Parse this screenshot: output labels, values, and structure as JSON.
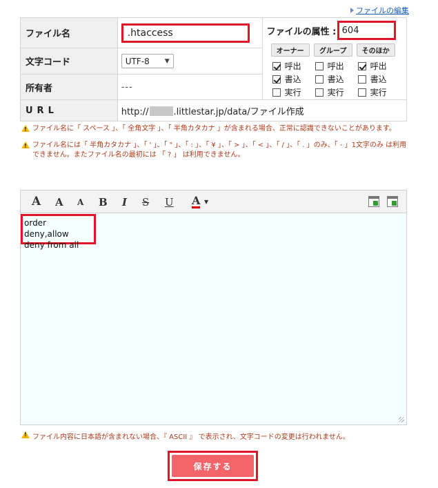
{
  "top_link": "ファイルの編集",
  "form": {
    "filename_label": "ファイル名",
    "filename_value": ".htaccess",
    "encoding_label": "文字コード",
    "encoding_value": "UTF-8",
    "owner_label": "所有者",
    "owner_value": "---",
    "url_label": "URL",
    "url_prefix": "http://",
    "url_suffix": ".littlestar.jp/data/ファイル作成"
  },
  "attributes": {
    "label": "ファイルの属性 :",
    "value": "604",
    "groups": [
      "オーナー",
      "グループ",
      "そのほか"
    ],
    "permissions": [
      "呼出",
      "書込",
      "実行"
    ],
    "checked": [
      [
        true,
        true,
        false
      ],
      [
        false,
        false,
        false
      ],
      [
        true,
        false,
        false
      ]
    ]
  },
  "notes": {
    "note1": "ファイル名に「 スペース 」、「 全角文字 」、「 半角カタカナ 」が含まれる場合、正常に認識できないことがあります。",
    "note2": "ファイル名には「 半角カタカナ 」、「 ' 」、「 \" 」、「 : 」、「 ¥ 」、「 > 」、「 < 」、「 / 」、「 . 」のみ、「 - 」1文字のみ は利用できません。またファイル名の最初には 「 ? 」 は利用できません。",
    "note_bottom": "ファイル内容に日本語が含まれない場合、『 ASCII 』 で表示され、文字コードの変更は行われません。"
  },
  "editor": {
    "toolbar": {
      "font_large": "A",
      "font_medium": "A",
      "font_small": "A",
      "bold": "B",
      "italic": "I",
      "strike": "S",
      "underline": "U",
      "color": "A"
    },
    "line1": "order deny,allow",
    "line2": "deny from all"
  },
  "save_label": "保存する",
  "icons": {
    "warning": "warning-icon",
    "download": "download-icon",
    "upload": "upload-icon"
  }
}
